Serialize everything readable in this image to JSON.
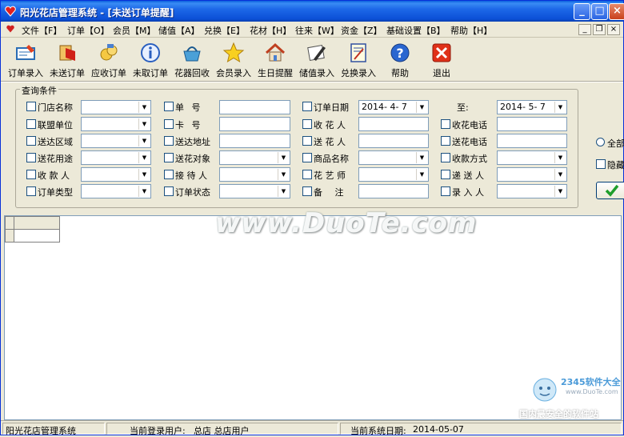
{
  "window": {
    "title": "阳光花店管理系统 - [未送订单提醒]"
  },
  "menu": {
    "items": [
      "文件【F】",
      "订单【O】",
      "会员【M】",
      "储值【A】",
      "兑换【E】",
      "花材【H】",
      "往来【W】",
      "资金【Z】",
      "基础设置【B】",
      "帮助【H】"
    ]
  },
  "toolbar": {
    "buttons": [
      {
        "label": "订单录入",
        "icon": "order-entry-icon"
      },
      {
        "label": "未送订单",
        "icon": "undelivered-order-icon"
      },
      {
        "label": "应收订单",
        "icon": "receivable-order-icon"
      },
      {
        "label": "未取订单",
        "icon": "info-icon"
      },
      {
        "label": "花器回收",
        "icon": "basket-icon"
      },
      {
        "label": "会员录入",
        "icon": "star-icon"
      },
      {
        "label": "生日提醒",
        "icon": "house-icon"
      },
      {
        "label": "储值录入",
        "icon": "pen-icon"
      },
      {
        "label": "兑换录入",
        "icon": "notebook-icon"
      },
      {
        "label": "帮助",
        "icon": "help-icon"
      },
      {
        "label": "退出",
        "icon": "exit-icon"
      }
    ]
  },
  "query": {
    "title": "查询条件",
    "col1": [
      "门店名称",
      "联盟单位",
      "送达区域",
      "送花用途",
      "收 款 人",
      "订单类型"
    ],
    "col2": [
      "单 号",
      "卡 号",
      "送达地址",
      "送花对象",
      "接 待 人",
      "订单状态"
    ],
    "col3": [
      "订单日期",
      "收 花 人",
      "送 花 人",
      "商品名称",
      "花 艺 师",
      "备 注"
    ],
    "col4": [
      "收花电话",
      "送花电话",
      "收款方式",
      "递 送 人",
      "录 入 人"
    ],
    "date_from": "2014- 4- 7",
    "date_to_label": "至:",
    "date_to": "2014- 5- 7",
    "side_radio": "全部",
    "side_check": "隐藏"
  },
  "status": {
    "app_name": "阳光花店管理系统",
    "user_label": "当前登录用户:",
    "user_value": "总店 总店用户",
    "date_label": "当前系统日期:",
    "date_value": "2014-05-07"
  },
  "watermark": {
    "main": "www.DuoTe.com",
    "logo_text": "2345软件大全",
    "logo_url": "www.DuoTe.com",
    "logo_caption": "国内最安全的软件站"
  },
  "colors": {
    "titlebar": "#0b4fd6",
    "window_bg": "#ece9d8",
    "ok_check": "#1f9e2b"
  }
}
